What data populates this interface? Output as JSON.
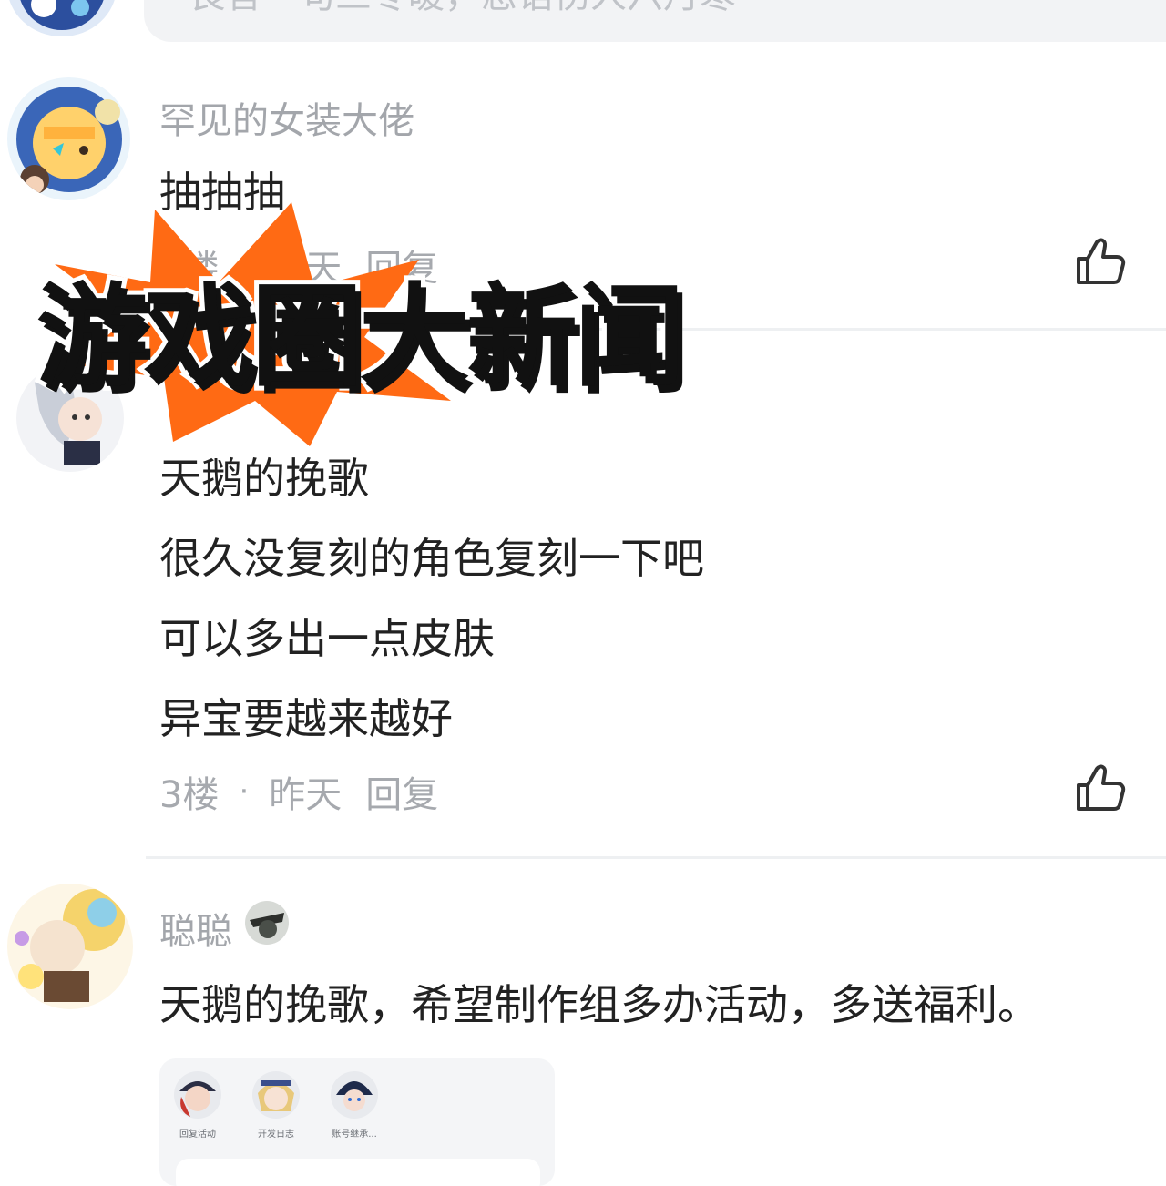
{
  "top_input": {
    "placeholder": "良言一句三冬暖，恶语伤人六月寒"
  },
  "comments": [
    {
      "username": "罕见的女装大佬",
      "lines": [
        "抽抽抽"
      ],
      "floor": "2楼",
      "time": "昨天",
      "reply": "回复"
    },
    {
      "username": "",
      "lines": [
        "天鹅的挽歌",
        "很久没复刻的角色复刻一下吧",
        "可以多出一点皮肤",
        "异宝要越来越好"
      ],
      "floor": "3楼",
      "time": "昨天",
      "reply": "回复"
    },
    {
      "username": "聪聪",
      "lines": [
        "天鹅的挽歌，希望制作组多办活动，多送福利。"
      ]
    }
  ],
  "separator_dot": "·",
  "stickers": [
    {
      "caption": "回复活动"
    },
    {
      "caption": "开发日志"
    },
    {
      "caption": "账号继承..."
    }
  ],
  "banner": {
    "text": "游戏圈大新闻",
    "burst_color": "#ff6a14"
  },
  "icons": {
    "like": "thumbs-up-icon"
  }
}
